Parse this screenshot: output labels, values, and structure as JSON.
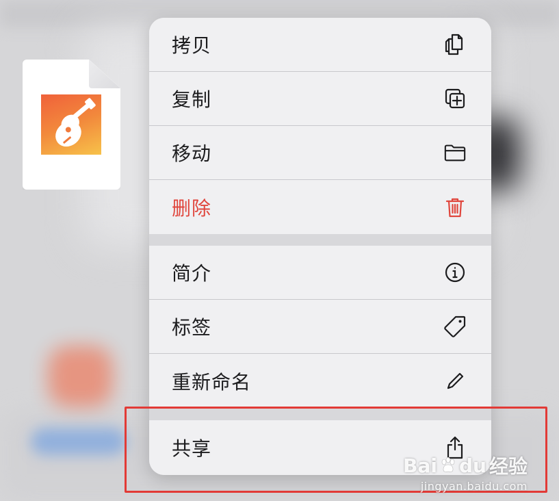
{
  "menu": {
    "items": [
      {
        "label": "拷贝",
        "icon": "copy-icon"
      },
      {
        "label": "复制",
        "icon": "duplicate-icon"
      },
      {
        "label": "移动",
        "icon": "folder-icon"
      },
      {
        "label": "删除",
        "icon": "trash-icon",
        "danger": true
      },
      {
        "label": "简介",
        "icon": "info-icon"
      },
      {
        "label": "标签",
        "icon": "tag-icon"
      },
      {
        "label": "重新命名",
        "icon": "pencil-icon"
      },
      {
        "label": "共享",
        "icon": "share-icon"
      }
    ]
  },
  "file": {
    "icon": "garageband-icon"
  },
  "watermark": {
    "brand_left": "Bai",
    "brand_right": "经验",
    "brand_du": "du",
    "url": "jingyan.baidu.com"
  },
  "colors": {
    "danger": "#e0463d",
    "highlight": "#e23a36",
    "menu_bg": "#f0f0f2",
    "separator": "#d8d8db"
  }
}
